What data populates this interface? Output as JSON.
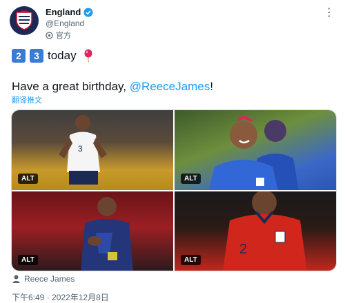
{
  "author": {
    "name": "England",
    "handle": "@England",
    "verified_icon": "verified-badge-icon",
    "official_label": "官方",
    "avatar_icon": "three-lions-crest-icon"
  },
  "tweet": {
    "count_digits": [
      "2",
      "3"
    ],
    "line1_word": "today",
    "balloon_icon": "balloon-emoji-icon",
    "line2_text": "Have a great birthday, ",
    "line2_mention": "@ReeceJames",
    "line2_end": "!",
    "translate_label": "翻译推文"
  },
  "media": {
    "photos": [
      {
        "alt_label": "ALT"
      },
      {
        "alt_label": "ALT"
      },
      {
        "alt_label": "ALT"
      },
      {
        "alt_label": "ALT"
      }
    ]
  },
  "tagged_user": "Reece James",
  "timestamp": "下午6:49 · 2022年12月8日",
  "colors": {
    "link": "#1d9bf0",
    "keycap": "#3a7bd5",
    "text": "#0f1419",
    "muted": "#536471"
  }
}
